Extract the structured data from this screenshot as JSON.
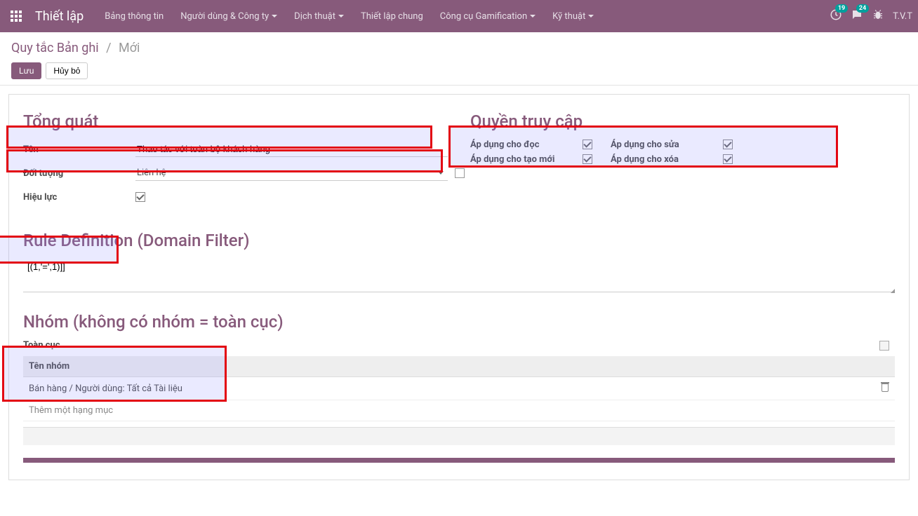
{
  "navbar": {
    "brand": "Thiết lập",
    "menu": [
      {
        "label": "Bảng thông tin",
        "has_caret": false
      },
      {
        "label": "Người dùng & Công ty",
        "has_caret": true
      },
      {
        "label": "Dịch thuật",
        "has_caret": true
      },
      {
        "label": "Thiết lập chung",
        "has_caret": false
      },
      {
        "label": "Công cụ Gamification",
        "has_caret": true
      },
      {
        "label": "Kỹ thuật",
        "has_caret": true
      }
    ],
    "badge_clock": "19",
    "badge_chat": "24",
    "user": "T.V.T"
  },
  "breadcrumb": {
    "root": "Quy tắc Bản ghi",
    "current": "Mới"
  },
  "buttons": {
    "save": "Lưu",
    "discard": "Hủy bỏ"
  },
  "sections": {
    "general": "Tổng quát",
    "access": "Quyền truy cập",
    "rule_def": "Rule Definition (Domain Filter)",
    "groups": "Nhóm (không có nhóm = toàn cục)"
  },
  "fields": {
    "name_label": "Tên",
    "name_value": "Thao tác với toàn bộ khách hàng",
    "object_label": "Đối tượng",
    "object_value": "Liên hệ",
    "active_label": "Hiệu lực",
    "global_label": "Toàn cục"
  },
  "access": {
    "read": "Áp dụng cho đọc",
    "write": "Áp dụng cho sửa",
    "create": "Áp dụng cho tạo mới",
    "delete": "Áp dụng cho xóa"
  },
  "domain_value": "[(1,'=',1)]]",
  "groups_table": {
    "header": "Tên nhóm",
    "rows": [
      "Bán hàng / Người dùng: Tất cả Tài liệu"
    ],
    "add_line": "Thêm một hạng mục"
  }
}
